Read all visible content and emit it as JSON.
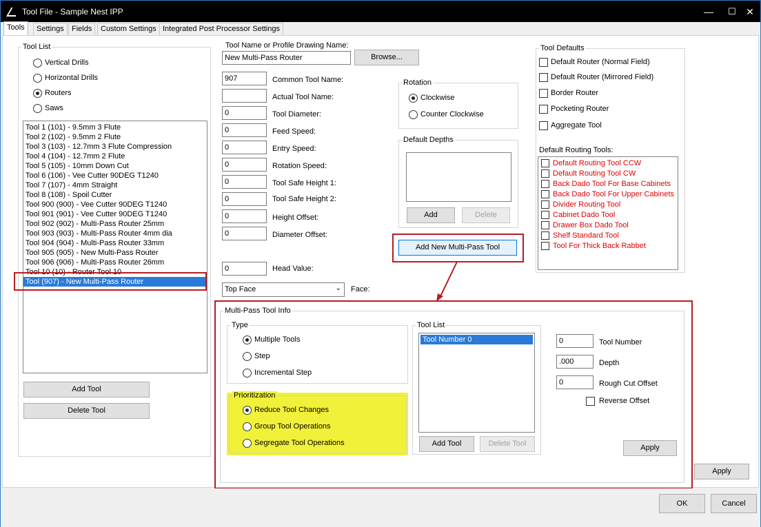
{
  "window": {
    "title": "Tool File - Sample Nest IPP",
    "minimize": "—",
    "maximize": "☐",
    "close": "✕"
  },
  "tabs": [
    "Tools",
    "Settings",
    "Fields",
    "Custom Settings",
    "Integrated Post Processor Settings"
  ],
  "tool_list": {
    "label": "Tool List",
    "types": [
      "Vertical Drills",
      "Horizontal Drills",
      "Routers",
      "Saws"
    ],
    "selected_type": "Routers",
    "items": [
      "Tool 1 (101) - 9.5mm 3 Flute",
      "Tool 2 (102) - 9.5mm 2 Flute",
      "Tool 3 (103) - 12.7mm  3 Flute Compression",
      "Tool 4 (104) - 12.7mm 2 Flute",
      "Tool 5 (105) - 10mm Down Cut",
      "Tool 6 (106) - Vee Cutter 90DEG T1240",
      "Tool 7 (107) - 4mm Straight",
      "Tool 8 (108) - Spoil Cutter",
      "Tool 900 (900) - Vee Cutter 90DEG T1240",
      "Tool 901 (901) - Vee Cutter 90DEG T1240",
      "Tool 902 (902) - Multi-Pass Router 25mm",
      "Tool 903 (903) - Multi-Pass Router 4mm dia",
      "Tool 904 (904) - Multi-Pass Router 33mm",
      "Tool 905 (905) - New Multi-Pass Router",
      "Tool 906 (906) - Multi-Pass Router 26mm",
      "Tool 10 (10) - Router Tool 10",
      "Tool  (907) - New Multi-Pass Router"
    ],
    "selected_index": 16,
    "add_button": "Add Tool",
    "delete_button": "Delete Tool"
  },
  "tool_props": {
    "name_label": "Tool Name or Profile Drawing Name:",
    "name_value": "New Multi-Pass Router",
    "browse_button": "Browse...",
    "fields": [
      {
        "label": "Common Tool Name:",
        "value": "907"
      },
      {
        "label": "Actual Tool Name:",
        "value": ""
      },
      {
        "label": "Tool Diameter:",
        "value": "0"
      },
      {
        "label": "Feed Speed:",
        "value": "0"
      },
      {
        "label": "Entry Speed:",
        "value": "0"
      },
      {
        "label": "Rotation Speed:",
        "value": "0"
      },
      {
        "label": "Tool Safe Height 1:",
        "value": "0"
      },
      {
        "label": "Tool Safe Height 2:",
        "value": "0"
      },
      {
        "label": "Height Offset:",
        "value": "0"
      },
      {
        "label": "Diameter Offset:",
        "value": "0"
      }
    ],
    "head_label": "Head Value:",
    "head_value": "0",
    "face_value": "Top Face",
    "face_label": "Face:"
  },
  "rotation": {
    "label": "Rotation",
    "options": [
      "Clockwise",
      "Counter Clockwise"
    ],
    "selected": "Clockwise"
  },
  "default_depths": {
    "label": "Default Depths",
    "add_button": "Add",
    "delete_button": "Delete"
  },
  "add_multipass_button": "Add New Multi-Pass Tool",
  "tool_defaults": {
    "label": "Tool Defaults",
    "options": [
      "Default Router (Normal Field)",
      "Default Router (Mirrored Field)",
      "Border Router",
      "Pocketing Router",
      "Aggregate Tool"
    ],
    "routing_label": "Default Routing Tools:",
    "routing_items": [
      "Default Routing Tool CCW",
      "Default Routing Tool CW",
      "Back Dado Tool For Base Cabinets",
      "Back Dado Tool For Upper Cabinets",
      "Divider Routing Tool",
      "Cabinet Dado Tool",
      "Drawer Box Dado Tool",
      "Shelf Standard Tool",
      "Tool For Thick Back Rabbet"
    ],
    "routing_color": "#e00000"
  },
  "multipass": {
    "label": "Multi-Pass Tool Info",
    "type_label": "Type",
    "types": [
      "Multiple Tools",
      "Step",
      "Incremental Step"
    ],
    "selected_type": "Multiple Tools",
    "prior_label": "Prioritization",
    "priorities": [
      "Reduce Tool Changes",
      "Group Tool Operations",
      "Segregate Tool Operations"
    ],
    "selected_priority": "Reduce Tool Changes",
    "list_label": "Tool List",
    "list_items": [
      "Tool Number 0"
    ],
    "add_tool": "Add Tool",
    "delete_tool": "Delete Tool",
    "tool_number_value": "0",
    "tool_number_label": "Tool Number",
    "depth_value": ".000",
    "depth_label": "Depth",
    "rough_value": "0",
    "rough_label": "Rough Cut Offset",
    "reverse_label": "Reverse Offset",
    "apply": "Apply"
  },
  "main_apply": "Apply",
  "ok_button": "OK",
  "cancel_button": "Cancel",
  "highlight_color": "#b51d22",
  "prioritization_bg": "#f1f13a"
}
